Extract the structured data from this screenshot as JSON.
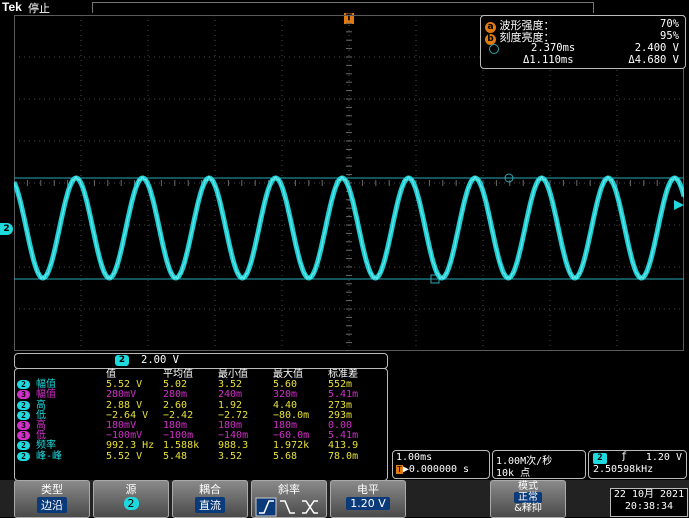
{
  "header": {
    "brand": "Tek",
    "run_state": "停止"
  },
  "trigger_marker": "T",
  "channel_ground_marker": "2",
  "info_panel": {
    "a_label": "a",
    "a_text": "波形强度：",
    "a_value": "70%",
    "b_label": "b",
    "b_text": "刻度亮度：",
    "b_value": "95%",
    "cursor1_time": "2.370ms",
    "cursor1_volt": "2.400 V",
    "delta_time": "Δ1.110ms",
    "delta_volt": "Δ4.680 V"
  },
  "scale_bar": {
    "channel": "2",
    "value": "2.00 V"
  },
  "measurements": {
    "headers": [
      "值",
      "平均值",
      "最小值",
      "最大值",
      "标准差"
    ],
    "rows": [
      {
        "ch": "2",
        "color": "cyan",
        "name": "幅值",
        "vals": [
          "5.52 V",
          "5.02",
          "3.52",
          "5.60",
          "552m"
        ]
      },
      {
        "ch": "3",
        "color": "mag",
        "name": "幅值",
        "vals": [
          "280mV",
          "280m",
          "240m",
          "320m",
          "5.41m"
        ]
      },
      {
        "ch": "2",
        "color": "cyan",
        "name": "高",
        "vals": [
          "2.88 V",
          "2.60",
          "1.92",
          "4.40",
          "273m"
        ]
      },
      {
        "ch": "2",
        "color": "cyan",
        "name": "低",
        "vals": [
          "−2.64 V",
          "−2.42",
          "−2.72",
          "−80.0m",
          "293m"
        ]
      },
      {
        "ch": "3",
        "color": "mag",
        "name": "高",
        "vals": [
          "180mV",
          "180m",
          "180m",
          "180m",
          "0.00"
        ]
      },
      {
        "ch": "3",
        "color": "mag",
        "name": "低",
        "vals": [
          "−100mV",
          "−100m",
          "−140m",
          "−60.0m",
          "5.41m"
        ]
      },
      {
        "ch": "2",
        "color": "cyan",
        "name": "频率",
        "vals": [
          "992.3 Hz",
          "1.588k",
          "988.3",
          "1.972k",
          "413.9"
        ]
      },
      {
        "ch": "2",
        "color": "cyan",
        "name": "峰-峰",
        "vals": [
          "5.52 V",
          "5.48",
          "3.52",
          "5.68",
          "78.0m"
        ]
      }
    ]
  },
  "timebase": {
    "scale": "1.00ms",
    "trig_pos": "▶0.000000 s",
    "trig_marker": "T"
  },
  "acquisition": {
    "rate": "1.00M次/秒",
    "points": "10k 点"
  },
  "trigger_status": {
    "channel": "2",
    "slope": "ƒ",
    "level": "1.20 V",
    "freq": "2.50598kHz"
  },
  "bottom_buttons": {
    "type_label": "类型",
    "type_value": "边沿",
    "source_label": "源",
    "source_value": "2",
    "coupling_label": "耦合",
    "coupling_value": "直流",
    "slope_label": "斜率",
    "level_label": "电平",
    "level_value": "1.20 V",
    "mode_label": "模式",
    "mode_value": "正常",
    "mode_extra": "&释抑"
  },
  "datetime": {
    "date": "22 10月 2021",
    "time": "20:38:34"
  },
  "colors": {
    "waveform": "#1ed9de",
    "ch3": "#d030c8",
    "cursor": "#2aa8b4",
    "grid": "#5a5a5a",
    "trigger": "#e07a10"
  }
}
